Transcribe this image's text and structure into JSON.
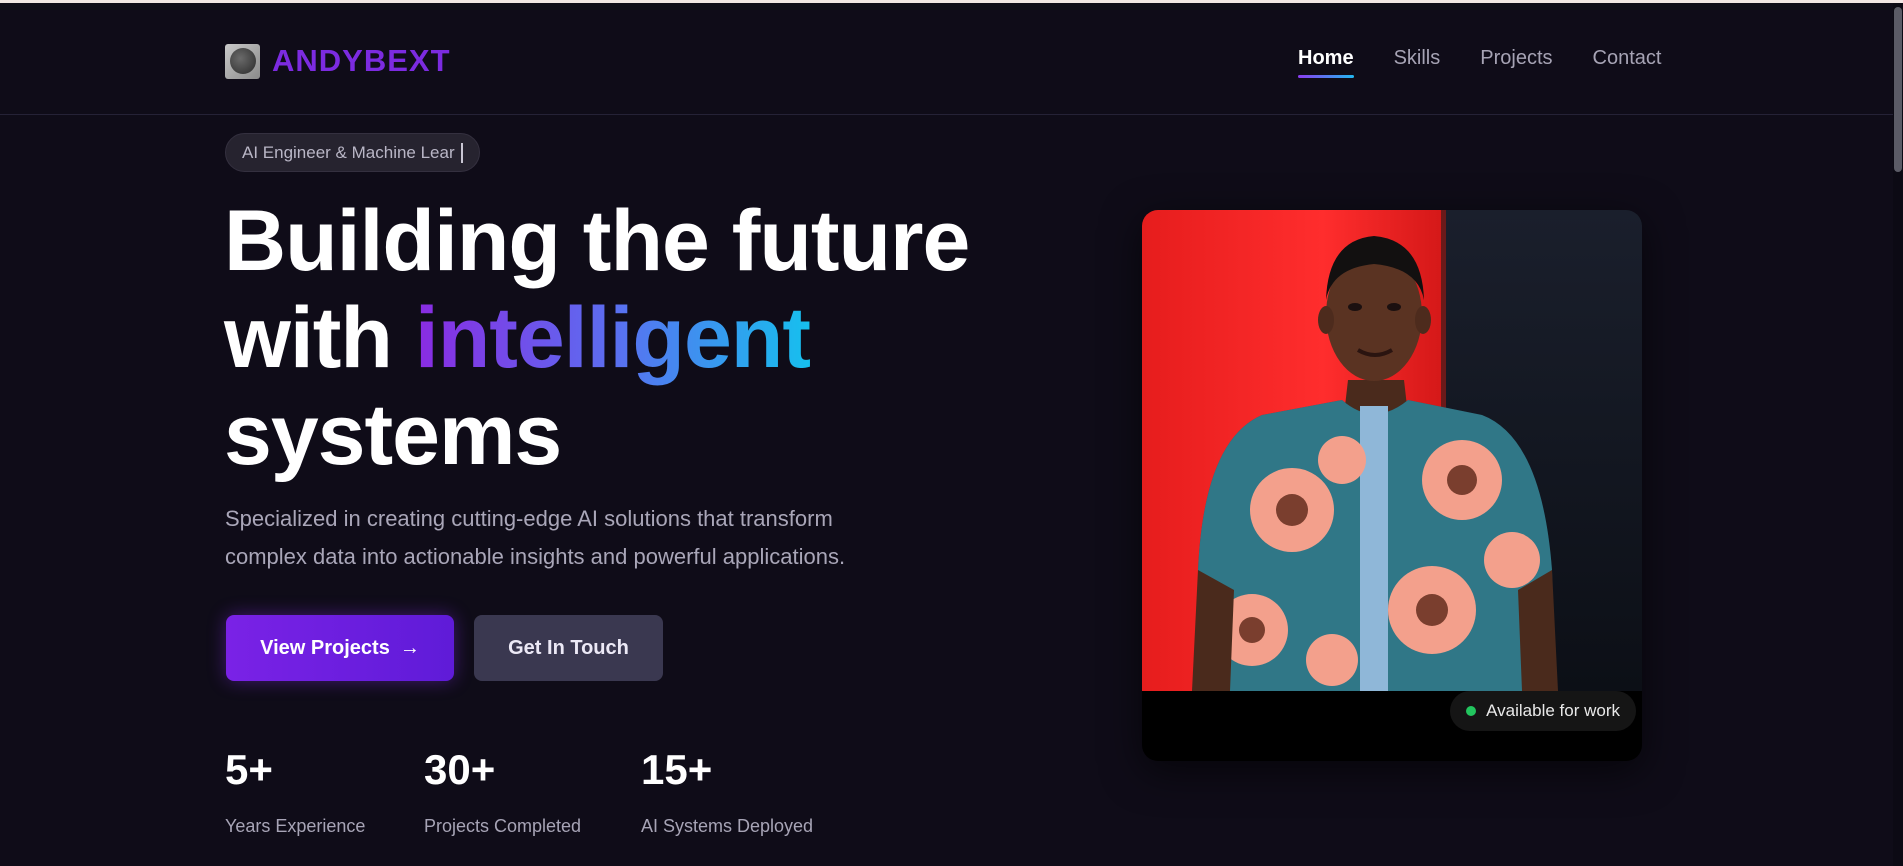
{
  "brand": {
    "name": "ANDYBEXT",
    "logo_icon": "logo-icon",
    "color": "#7c2be0"
  },
  "nav": {
    "items": [
      {
        "label": "Home",
        "active": true
      },
      {
        "label": "Skills",
        "active": false
      },
      {
        "label": "Projects",
        "active": false
      },
      {
        "label": "Contact",
        "active": false
      }
    ]
  },
  "hero": {
    "tagline": "AI Engineer & Machine Lear",
    "headline_line1": "Building the future",
    "headline_line2_plain": "with ",
    "headline_line2_highlight": "intelligent",
    "headline_line3": "systems",
    "subtitle_line1": "Specialized in creating cutting-edge AI solutions that transform",
    "subtitle_line2": "complex data into actionable insights and powerful applications.",
    "primary_button": "View Projects",
    "primary_button_icon": "→",
    "secondary_button": "Get In Touch",
    "stats": [
      {
        "value": "5+",
        "label": "Years Experience"
      },
      {
        "value": "30+",
        "label": "Projects Completed"
      },
      {
        "value": "15+",
        "label": "AI Systems Deployed"
      }
    ]
  },
  "profile": {
    "availability": "Available for work",
    "availability_color": "#22c55e"
  },
  "colors": {
    "background": "#0f0c18",
    "accent_purple": "#7a22e6",
    "accent_cyan": "#16c0ee"
  }
}
